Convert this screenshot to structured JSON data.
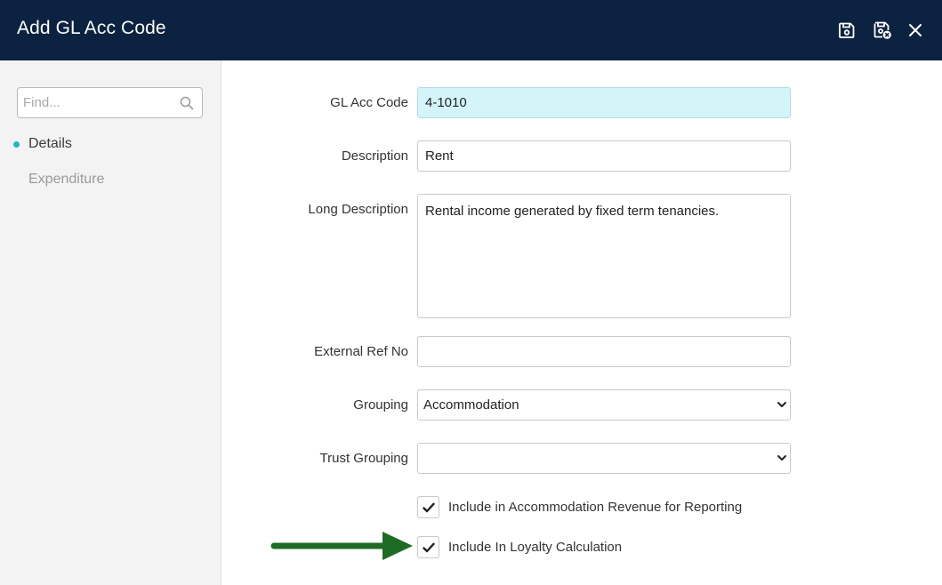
{
  "header": {
    "title": "Add GL Acc Code",
    "save_icon": "save-icon",
    "save_close_icon": "save-and-close-icon",
    "close_icon": "close-icon",
    "background": "#0b2240"
  },
  "sidebar": {
    "search_placeholder": "Find...",
    "items": [
      {
        "label": "Details",
        "active": true
      },
      {
        "label": "Expenditure",
        "active": false
      }
    ],
    "accent": "#1cb5c9"
  },
  "form": {
    "gl_acc_code": {
      "label": "GL Acc Code",
      "value": "4-1010"
    },
    "description": {
      "label": "Description",
      "value": "Rent"
    },
    "long_description": {
      "label": "Long Description",
      "value": "Rental income generated by fixed term tenancies."
    },
    "external_ref_no": {
      "label": "External Ref No",
      "value": ""
    },
    "grouping": {
      "label": "Grouping",
      "value": "Accommodation"
    },
    "trust_grouping": {
      "label": "Trust Grouping",
      "value": ""
    },
    "include_accommodation_revenue": {
      "label": "Include in Accommodation Revenue for Reporting",
      "checked": true
    },
    "include_loyalty": {
      "label": "Include In Loyalty Calculation",
      "checked": true
    }
  },
  "annotation": {
    "arrow_color": "#1e6b24"
  }
}
